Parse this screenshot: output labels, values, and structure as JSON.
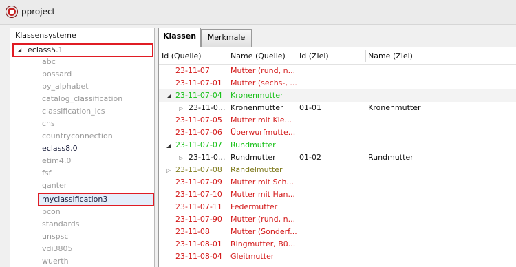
{
  "window": {
    "title": "pproject"
  },
  "left_panel": {
    "header": "Klassensysteme",
    "root": "eclass5.1",
    "items": [
      "abc",
      "bossard",
      "by_alphabet",
      "catalog_classification",
      "classification_ics",
      "cns",
      "countryconnection",
      "eclass8.0",
      "etim4.0",
      "fsf",
      "ganter",
      "myclassification3",
      "pcon",
      "standards",
      "unspsc",
      "vdi3805",
      "wuerth"
    ]
  },
  "tabs": [
    "Klassen",
    "Merkmale"
  ],
  "table": {
    "columns": [
      "Id (Quelle)",
      "Name (Quelle)",
      "Id (Ziel)",
      "Name (Ziel)"
    ],
    "rows": [
      {
        "id": "23-11-07",
        "name": "Mutter (rund, n...",
        "id_ziel": "",
        "name_ziel": ""
      },
      {
        "id": "23-11-07-01",
        "name": "Mutter (sechs-, ...",
        "id_ziel": "",
        "name_ziel": ""
      },
      {
        "id": "23-11-07-04",
        "name": "Kronenmutter",
        "id_ziel": "",
        "name_ziel": ""
      },
      {
        "id": "23-11-0...",
        "name": "Kronenmutter",
        "id_ziel": "01-01",
        "name_ziel": "Kronenmutter"
      },
      {
        "id": "23-11-07-05",
        "name": "Mutter mit Kle...",
        "id_ziel": "",
        "name_ziel": ""
      },
      {
        "id": "23-11-07-06",
        "name": "Überwurfmutte...",
        "id_ziel": "",
        "name_ziel": ""
      },
      {
        "id": "23-11-07-07",
        "name": "Rundmutter",
        "id_ziel": "",
        "name_ziel": ""
      },
      {
        "id": "23-11-0...",
        "name": "Rundmutter",
        "id_ziel": "01-02",
        "name_ziel": "Rundmutter"
      },
      {
        "id": "23-11-07-08",
        "name": "Rändelmutter",
        "id_ziel": "",
        "name_ziel": ""
      },
      {
        "id": "23-11-07-09",
        "name": "Mutter mit Sch...",
        "id_ziel": "",
        "name_ziel": ""
      },
      {
        "id": "23-11-07-10",
        "name": "Mutter mit Han...",
        "id_ziel": "",
        "name_ziel": ""
      },
      {
        "id": "23-11-07-11",
        "name": "Federmutter",
        "id_ziel": "",
        "name_ziel": ""
      },
      {
        "id": "23-11-07-90",
        "name": "Mutter (rund, n...",
        "id_ziel": "",
        "name_ziel": ""
      },
      {
        "id": "23-11-08",
        "name": "Mutter (Sonderf...",
        "id_ziel": "",
        "name_ziel": ""
      },
      {
        "id": "23-11-08-01",
        "name": "Ringmutter, Bü...",
        "id_ziel": "",
        "name_ziel": ""
      },
      {
        "id": "23-11-08-04",
        "name": "Gleitmutter",
        "id_ziel": "",
        "name_ziel": ""
      }
    ]
  },
  "colors": {
    "highlight_border": "#e01c24",
    "unmapped": "#d31717",
    "mapped": "#16c016",
    "partial": "#7f7a1c"
  }
}
